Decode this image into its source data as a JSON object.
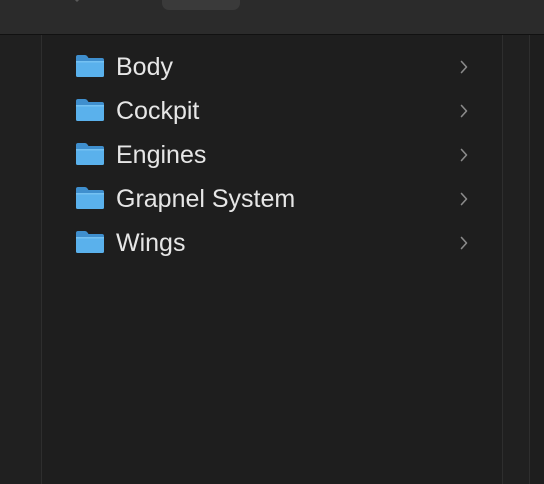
{
  "folders": [
    {
      "name": "Body",
      "icon": "folder-icon",
      "has_children": true
    },
    {
      "name": "Cockpit",
      "icon": "folder-icon",
      "has_children": true
    },
    {
      "name": "Engines",
      "icon": "folder-icon",
      "has_children": true
    },
    {
      "name": "Grapnel System",
      "icon": "folder-icon",
      "has_children": true
    },
    {
      "name": "Wings",
      "icon": "folder-icon",
      "has_children": true
    }
  ],
  "colors": {
    "background": "#1e1e1e",
    "text": "#e6e6e6",
    "folder_blue": "#5ab1ec",
    "chevron": "#8a8a8a"
  },
  "icons": {
    "folder": "folder-icon",
    "disclosure": "chevron-right-icon"
  }
}
